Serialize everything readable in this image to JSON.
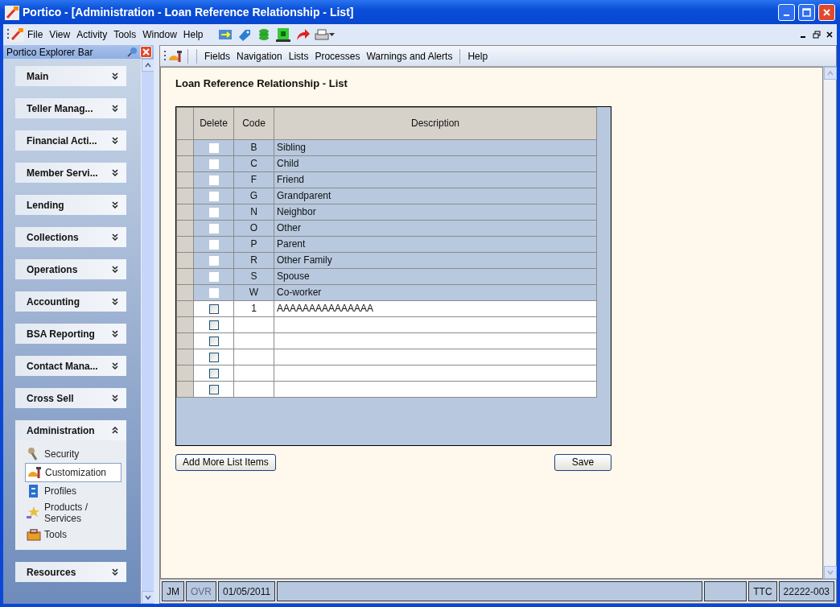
{
  "window": {
    "title": "Portico - [Administration - Loan Reference Relationship - List]"
  },
  "menu_bar": {
    "items": [
      "File",
      "View",
      "Activity",
      "Tools",
      "Window",
      "Help"
    ]
  },
  "explorer_bar": {
    "title": "Portico Explorer Bar",
    "sections": [
      {
        "label": "Main",
        "expanded": false
      },
      {
        "label": "Teller Manag...",
        "expanded": false
      },
      {
        "label": "Financial Acti...",
        "expanded": false
      },
      {
        "label": "Member Servi...",
        "expanded": false
      },
      {
        "label": "Lending",
        "expanded": false
      },
      {
        "label": "Collections",
        "expanded": false
      },
      {
        "label": "Operations",
        "expanded": false
      },
      {
        "label": "Accounting",
        "expanded": false
      },
      {
        "label": "BSA Reporting",
        "expanded": false
      },
      {
        "label": "Contact Mana...",
        "expanded": false
      },
      {
        "label": "Cross Sell",
        "expanded": false
      },
      {
        "label": "Administration",
        "expanded": true,
        "items": [
          {
            "label": "Security",
            "selected": false
          },
          {
            "label": "Customization",
            "selected": true
          },
          {
            "label": "Profiles",
            "selected": false
          },
          {
            "label": "Products / Services",
            "selected": false
          },
          {
            "label": "Tools",
            "selected": false
          }
        ]
      },
      {
        "label": "Resources",
        "expanded": false
      }
    ]
  },
  "toolbar": {
    "items": [
      "Fields",
      "Navigation",
      "Lists",
      "Processes",
      "Warnings and Alerts",
      "Help"
    ]
  },
  "page": {
    "title": "Loan Reference Relationship - List",
    "table": {
      "columns": [
        "Delete",
        "Code",
        "Description"
      ],
      "rows": [
        {
          "disabled": true,
          "checked": false,
          "code": "B",
          "description": "Sibling"
        },
        {
          "disabled": true,
          "checked": false,
          "code": "C",
          "description": "Child"
        },
        {
          "disabled": true,
          "checked": false,
          "code": "F",
          "description": "Friend"
        },
        {
          "disabled": true,
          "checked": false,
          "code": "G",
          "description": "Grandparent"
        },
        {
          "disabled": true,
          "checked": false,
          "code": "N",
          "description": "Neighbor"
        },
        {
          "disabled": true,
          "checked": false,
          "code": "O",
          "description": "Other"
        },
        {
          "disabled": true,
          "checked": false,
          "code": "P",
          "description": "Parent"
        },
        {
          "disabled": true,
          "checked": false,
          "code": "R",
          "description": "Other Family"
        },
        {
          "disabled": true,
          "checked": false,
          "code": "S",
          "description": "Spouse"
        },
        {
          "disabled": true,
          "checked": false,
          "code": "W",
          "description": "Co-worker"
        },
        {
          "disabled": false,
          "checked": false,
          "code": "1",
          "description": "AAAAAAAAAAAAAAA"
        },
        {
          "disabled": false,
          "checked": false
        },
        {
          "disabled": false,
          "checked": false
        },
        {
          "disabled": false,
          "checked": false
        },
        {
          "disabled": false,
          "checked": false
        },
        {
          "disabled": false,
          "checked": false
        }
      ]
    },
    "buttons": {
      "add": "Add More List Items",
      "save": "Save"
    }
  },
  "status_bar": [
    {
      "kind": "text",
      "text": "JM",
      "disabled": false
    },
    {
      "kind": "text",
      "text": "OVR",
      "disabled": true
    },
    {
      "kind": "text",
      "text": "01/05/2011",
      "disabled": false
    },
    {
      "kind": "wide"
    },
    {
      "kind": "spacer"
    },
    {
      "kind": "text",
      "text": "TTC",
      "disabled": false
    },
    {
      "kind": "text",
      "text": "22222-003",
      "disabled": false
    }
  ]
}
